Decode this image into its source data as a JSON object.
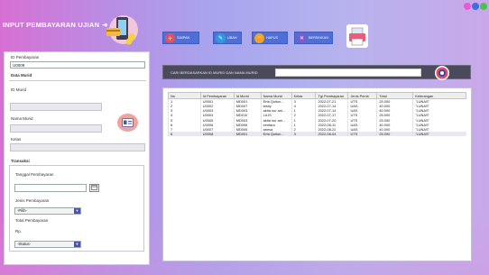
{
  "app": {
    "title": "INPUT PEMBAYARAN UJIAN"
  },
  "toolbar": {
    "save_label": "SIMPAN",
    "edit_label": "UBAH",
    "delete_label": "HAPUS",
    "clear_label": "BERSIHKAN"
  },
  "left": {
    "id_label": "ID Pembayaran",
    "id_value": "U0009",
    "student_section": "Data Murid",
    "student_id_label": "ID Murid",
    "student_name_label": "Nama Murid",
    "class_label": "Kelas",
    "transaction_section": "Transaksi",
    "date_label": "Tanggal Pembayaran",
    "payment_type_label": "Jenis Pembayaran",
    "payment_type_value": "-Pilih-",
    "total_label": "Total Pembayaran",
    "currency_prefix": "Rp.",
    "status_value": "-Status-"
  },
  "search": {
    "label": "CARI BERDASARKAN ID MURID DAN NAMA MURID"
  },
  "table": {
    "headers": [
      "No",
      "Id Pembayaran",
      "Id Murid",
      "Nama Murid",
      "Kelas",
      "Tgl Pembayaran",
      "Jenis Pemb",
      "Total",
      "Keterangan"
    ],
    "rows": [
      [
        "1",
        "U0001",
        "MD001",
        "Erfa Quiton...",
        "3",
        "2022-07-21",
        "UTS",
        "25.000",
        "\"LUNAS\""
      ],
      [
        "2",
        "U0002",
        "MD007",
        "lesby",
        "4",
        "2022-07-14",
        "UAS",
        "40.000",
        "\"LUNAS\""
      ],
      [
        "3",
        "U0003",
        "MD003",
        "akita nur am...",
        "1",
        "2022-07-14",
        "UAS",
        "40.000",
        "\"LUNAS\""
      ],
      [
        "4",
        "U0004",
        "MD010",
        "LILIS",
        "2",
        "2022-07-17",
        "UTS",
        "25.000",
        "\"LUNAS\""
      ],
      [
        "5",
        "U0005",
        "MD003",
        "akita nur am...",
        "1",
        "2022-07-20",
        "UTS",
        "25.000",
        "\"LUNAS\""
      ],
      [
        "6",
        "U0006",
        "MD006",
        "zentara",
        "1",
        "2022-08-11",
        "UAS",
        "40.000",
        "\"LUNAS\""
      ],
      [
        "7",
        "U0007",
        "MD005",
        "ariesa",
        "2",
        "2022-08-22",
        "UAS",
        "40.000",
        "\"LUNAS\""
      ],
      [
        "8",
        "U0008",
        "MD001",
        "Erfa Quiton...",
        "3",
        "2022-08-04",
        "UTS",
        "25.000",
        "\"LUNAS\""
      ]
    ]
  },
  "colors": {
    "primary_button": "#4f6fd6",
    "header_gradient_left": "#d76fd3",
    "header_gradient_right": "#a7a6ee"
  },
  "icons": {
    "save": "save-icon",
    "edit": "edit-icon",
    "delete": "delete-icon",
    "clear": "clear-icon",
    "print": "printer-icon",
    "search": "search-icon",
    "student_search": "student-card-icon"
  }
}
